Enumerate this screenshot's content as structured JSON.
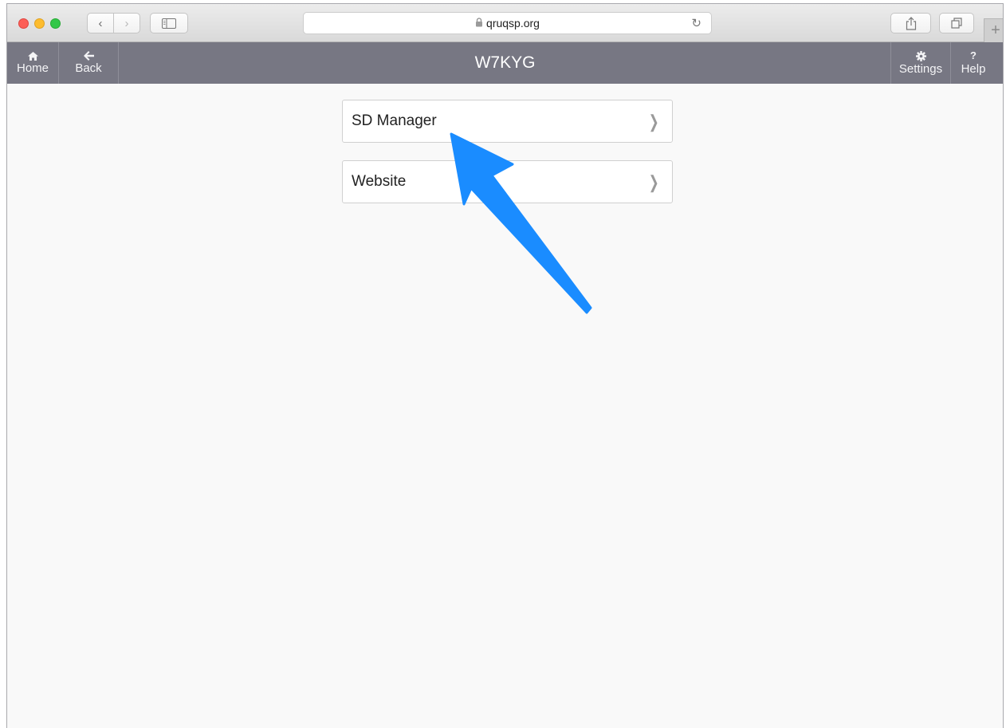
{
  "browser": {
    "url": "qruqsp.org",
    "new_tab_label": "+"
  },
  "header": {
    "title": "W7KYG",
    "home_label": "Home",
    "back_label": "Back",
    "settings_label": "Settings",
    "help_label": "Help"
  },
  "menu": {
    "items": [
      {
        "label": "SD Manager"
      },
      {
        "label": "Website"
      }
    ]
  },
  "colors": {
    "header_bg": "#777783",
    "arrow": "#1a8cff"
  }
}
